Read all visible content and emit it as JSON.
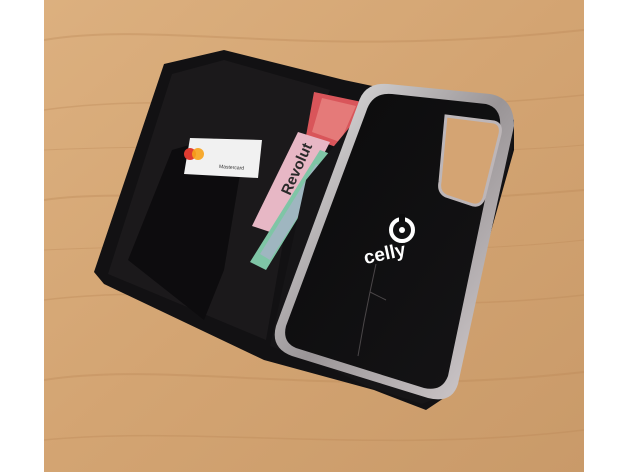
{
  "photo": {
    "case_brand": "celly",
    "card_brand": "Revolut",
    "small_card_text": "Mastercard"
  },
  "colors": {
    "wood": "#d7a978",
    "wood_dark": "#b98656",
    "leather": "#141214",
    "chrome": "#c9c3c6"
  }
}
